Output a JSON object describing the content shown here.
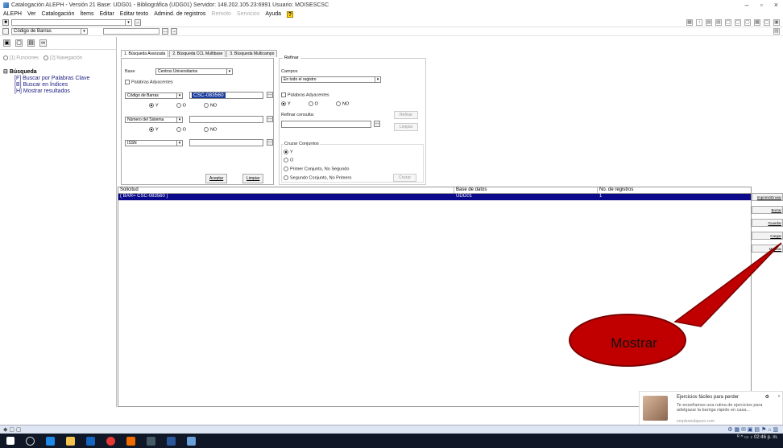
{
  "window": {
    "title": "Catalogación ALEPH - Versión 21 Base: UDG01 - Bibliográfica (UDG01) Servidor: 148.202.105.23:6991 Usuario: MOISESCSC"
  },
  "menu": [
    "ALEPH",
    "Ver",
    "Catalogación",
    "Ítems",
    "Editar",
    "Editar texto",
    "Admind. de registros",
    "Remoto",
    "Servicios",
    "Ayuda"
  ],
  "toolbar2": {
    "select_value": "Código de Barras"
  },
  "left": {
    "radio_functions": "[1] Funciones",
    "radio_navigation": "[2] Navegación",
    "tree_root": "Búsqueda",
    "tree_items": [
      "[F] Buscar por Palabras Clave",
      "[B] Buscar en Índices",
      "[H] Mostrar resultados"
    ]
  },
  "tabs": [
    "1. Búsqueda Avanzada",
    "2. Búsqueda CCL Multibase",
    "3. Búsqueda Multicampo"
  ],
  "form": {
    "base_label": "Base",
    "base_value": "Centros Universitarios",
    "palabras_adyacentes": "Palabras Adyacentes",
    "field1": "Código de Barras",
    "value1": "CSC-083560",
    "field2": "Número del Sistema",
    "field3": "ISSN",
    "r_y": "Y",
    "r_o": "O",
    "r_no": "NO",
    "aceptar": "Aceptar",
    "limpiar": "Limpiar"
  },
  "refinar": {
    "title": "Refinar",
    "campos_label": "Campos",
    "campos_value": "En todo el registro",
    "palabras_adyacentes": "Palabras Adyacentes",
    "y": "Y",
    "o": "O",
    "no": "NO",
    "refinar_consulta": "Refinar consulta:",
    "refinar_btn": "Refinar",
    "limpiar_btn": "Limpiar",
    "cruzar_title": "Cruzar Conjuntos",
    "c_y": "Y",
    "c_o": "O",
    "c_pns": "Primer Conjunto, No Segundo",
    "c_snp": "Segundo Conjunto, No Primero",
    "cruzar_btn": "Cruzar"
  },
  "results": {
    "headers": [
      "Solicitud",
      "Base de datos",
      "No. de registros"
    ],
    "rows": [
      {
        "query": "( BAR= CSC-083560 )",
        "db": "UDG01",
        "count": "1"
      }
    ]
  },
  "right_buttons": [
    "Imprimir/Enviar",
    "Borrar",
    "Guardar",
    "Cargar",
    "Mostrar"
  ],
  "callout": {
    "text": "Mostrar"
  },
  "notification": {
    "title": "Ejercicios fáciles para perder",
    "body": "Te enseñamos una rutina de ejercicios para adelgazar la barriga rápido en casa...",
    "source": "empleotodapuro.com"
  },
  "tray": {
    "time": "02:46 p. m."
  },
  "colors": {
    "selection": "#0a0a8a",
    "callout": "#c00000",
    "taskbar": "#101827"
  }
}
